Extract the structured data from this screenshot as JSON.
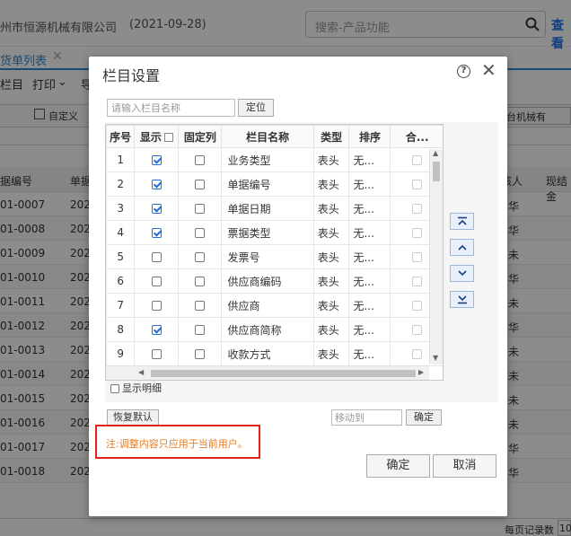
{
  "app": {
    "company": "州市恒源机械有限公司",
    "date": "(2021-09-28)",
    "search_placeholder": "搜索-产品功能",
    "query_link": "查看",
    "tab_label": "货单列表",
    "toolbar": {
      "columns": "栏目",
      "print": "打印",
      "more": "导"
    },
    "filter_custom": "自定义",
    "filter_customer": "台机械有",
    "grid_headers": [
      "据编号",
      "单据",
      "核人",
      "现结金"
    ],
    "grid_rows": [
      {
        "no": "01-0007",
        "d": "202",
        "a": "华"
      },
      {
        "no": "01-0008",
        "d": "202",
        "a": "华"
      },
      {
        "no": "01-0009",
        "d": "202",
        "a": "未"
      },
      {
        "no": "01-0010",
        "d": "202",
        "a": "华"
      },
      {
        "no": "01-0011",
        "d": "202",
        "a": "未"
      },
      {
        "no": "01-0012",
        "d": "202",
        "a": "华"
      },
      {
        "no": "01-0013",
        "d": "202",
        "a": "未"
      },
      {
        "no": "01-0014",
        "d": "202",
        "a": "未"
      },
      {
        "no": "01-0015",
        "d": "202",
        "a": "未"
      },
      {
        "no": "01-0016",
        "d": "202",
        "a": "未"
      },
      {
        "no": "01-0017",
        "d": "202",
        "a": "华"
      },
      {
        "no": "01-0018",
        "d": "202",
        "a": "华"
      }
    ],
    "per_page_label": "每页记录数",
    "per_page_value": "10"
  },
  "dialog": {
    "title": "栏目设置",
    "name_placeholder": "请输入栏目名称",
    "locate_label": "定位",
    "headers": {
      "seq": "序号",
      "show": "显示",
      "fixed": "固定列",
      "name": "栏目名称",
      "type": "类型",
      "sort": "排序",
      "merge": "合..."
    },
    "rows": [
      {
        "seq": "1",
        "show": true,
        "fixed": false,
        "name": "业务类型",
        "type": "表头",
        "sort": "无..."
      },
      {
        "seq": "2",
        "show": true,
        "fixed": false,
        "name": "单据编号",
        "type": "表头",
        "sort": "无..."
      },
      {
        "seq": "3",
        "show": true,
        "fixed": false,
        "name": "单据日期",
        "type": "表头",
        "sort": "无..."
      },
      {
        "seq": "4",
        "show": true,
        "fixed": false,
        "name": "票据类型",
        "type": "表头",
        "sort": "无..."
      },
      {
        "seq": "5",
        "show": false,
        "fixed": false,
        "name": "发票号",
        "type": "表头",
        "sort": "无..."
      },
      {
        "seq": "6",
        "show": false,
        "fixed": false,
        "name": "供应商编码",
        "type": "表头",
        "sort": "无..."
      },
      {
        "seq": "7",
        "show": false,
        "fixed": false,
        "name": "供应商",
        "type": "表头",
        "sort": "无..."
      },
      {
        "seq": "8",
        "show": true,
        "fixed": false,
        "name": "供应商简称",
        "type": "表头",
        "sort": "无..."
      },
      {
        "seq": "9",
        "show": false,
        "fixed": false,
        "name": "收款方式",
        "type": "表头",
        "sort": "无..."
      }
    ],
    "show_detail_label": "显示明细",
    "restore_label": "恢复默认",
    "move_to_placeholder": "移动到",
    "confirm_small_label": "确定",
    "note": "注:调整内容只应用于当前用户。",
    "ok_label": "确定",
    "cancel_label": "取消"
  },
  "colors": {
    "accent": "#2e8bd6",
    "check": "#1e6fd9",
    "note_border": "#e2231a",
    "note_text": "#e67a22"
  }
}
